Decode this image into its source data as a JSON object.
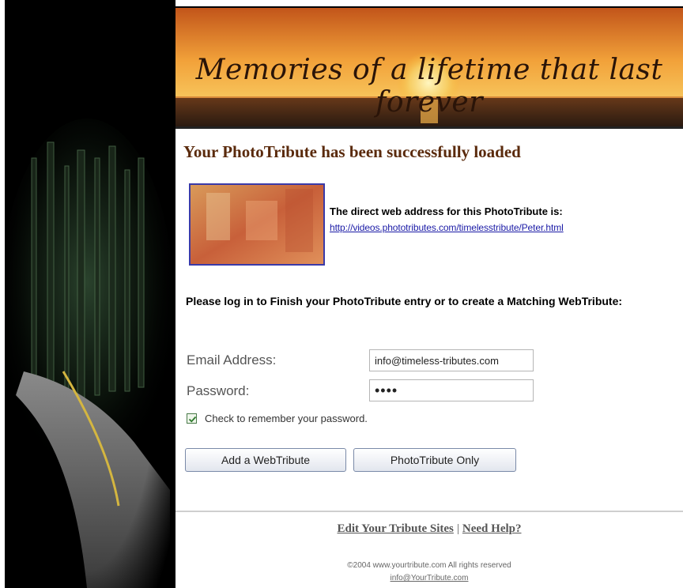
{
  "banner": {
    "title": "Memories of a lifetime that last forever"
  },
  "main": {
    "heading": "Your PhotoTribute has been successfully loaded",
    "direct_label": "The direct web address for this PhotoTribute is:",
    "direct_url": "http://videos.phototributes.com/timelesstribute/Peter.html",
    "login_prompt": "Please log in to Finish your PhotoTribute entry or to create a Matching WebTribute:"
  },
  "form": {
    "email_label": "Email Address:",
    "email_value": "info@timeless-tributes.com",
    "password_label": "Password:",
    "password_value": "••••",
    "remember_label": "Check to remember your password.",
    "remember_checked": true,
    "add_webtribute_label": "Add a WebTribute",
    "phototribute_only_label": "PhotoTribute Only"
  },
  "footer": {
    "edit_link": "Edit Your Tribute Sites",
    "separator": "|",
    "help_link": "Need Help?",
    "copyright": "©2004 www.yourtribute.com All rights reserved",
    "email": "info@YourTribute.com"
  },
  "icons": {
    "checkbox": "check-icon"
  },
  "colors": {
    "heading": "#5a2a0c",
    "link": "#1a1aa6",
    "banner_sun": "#f7b733"
  }
}
